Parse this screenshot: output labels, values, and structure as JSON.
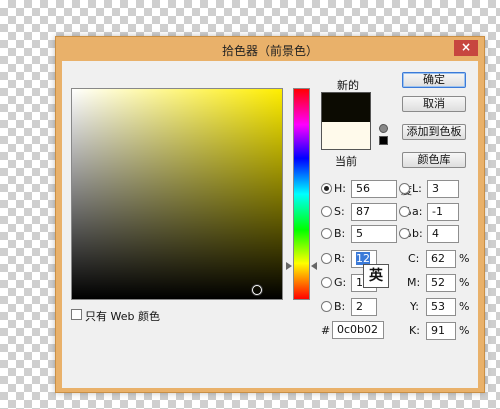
{
  "title": "拾色器（前景色）",
  "close_glyph": "×",
  "new_label": "新的",
  "current_label": "当前",
  "new_color": "#0c0b02",
  "current_color": "#fffaeb",
  "buttons": {
    "ok": "确定",
    "cancel": "取消",
    "add_swatch": "添加到色板",
    "libraries": "颜色库"
  },
  "hsb": {
    "h": {
      "label": "H:",
      "value": "56",
      "unit": "度"
    },
    "s": {
      "label": "S:",
      "value": "87",
      "unit": "%"
    },
    "b": {
      "label": "B:",
      "value": "5",
      "unit": "%"
    }
  },
  "lab": {
    "l": {
      "label": "L:",
      "value": "3"
    },
    "a": {
      "label": "a:",
      "value": "-1"
    },
    "b": {
      "label": "b:",
      "value": "4"
    }
  },
  "rgb": {
    "r": {
      "label": "R:",
      "value": "12"
    },
    "g": {
      "label": "G:",
      "value": "11"
    },
    "b": {
      "label": "B:",
      "value": "2"
    }
  },
  "cmyk": {
    "c": {
      "label": "C:",
      "value": "62",
      "unit": "%"
    },
    "m": {
      "label": "M:",
      "value": "52",
      "unit": "%"
    },
    "y": {
      "label": "Y:",
      "value": "53",
      "unit": "%"
    },
    "k": {
      "label": "K:",
      "value": "91",
      "unit": "%"
    }
  },
  "hex": {
    "label": "#",
    "value": "0c0b02"
  },
  "web_only_label": "只有 Web 颜色",
  "ime_indicator": "英",
  "hue_color": "#ffee00"
}
